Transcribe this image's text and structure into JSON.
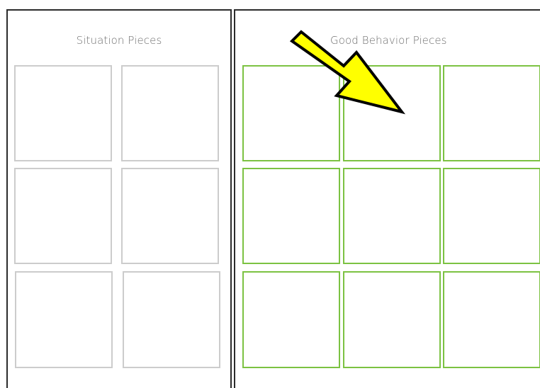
{
  "left_panel": {
    "title": "Situation Pieces",
    "slot_border_color": "#cccccc",
    "slot_count": 6
  },
  "right_panel": {
    "title": "Good Behavior Pieces",
    "slot_border_color": "#7cc242",
    "slot_count": 9
  },
  "pointer": {
    "icon": "arrow-icon",
    "fill_color": "#ffff00",
    "outline_color": "#000000"
  }
}
